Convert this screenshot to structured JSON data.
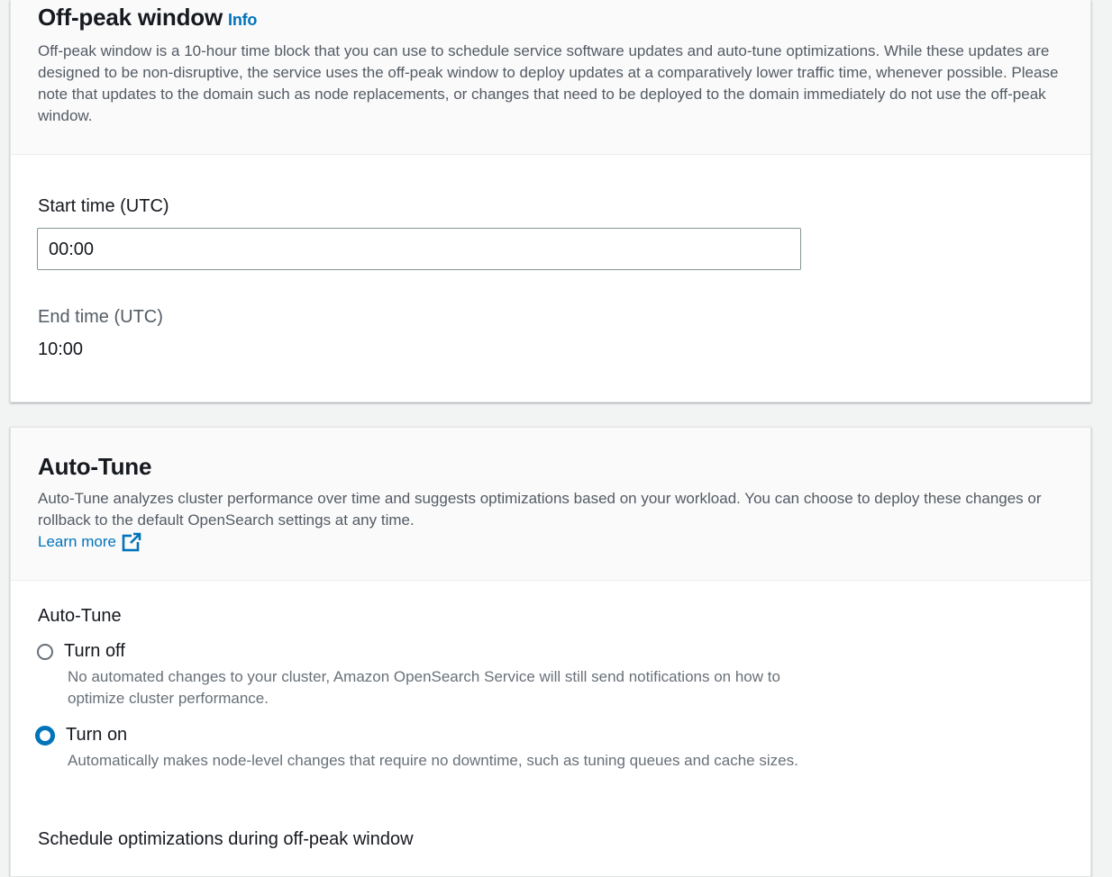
{
  "offpeak": {
    "title": "Off-peak window",
    "info": "Info",
    "description": "Off-peak window is a 10-hour time block that you can use to schedule service software updates and auto-tune optimizations. While these updates are designed to be non-disruptive, the service uses the off-peak window to deploy updates at a comparatively lower traffic time, whenever possible. Please note that updates to the domain such as node replacements, or changes that need to be deployed to the domain immediately do not use the off-peak window.",
    "start_label": "Start time (UTC)",
    "start_value": "00:00",
    "end_label": "End time (UTC)",
    "end_value": "10:00"
  },
  "autotune": {
    "title": "Auto-Tune",
    "description": "Auto-Tune analyzes cluster performance over time and suggests optimizations based on your workload. You can choose to deploy these changes or rollback to the default OpenSearch settings at any time.",
    "learn_more": "Learn more",
    "field_label": "Auto-Tune",
    "options": [
      {
        "label": "Turn off",
        "description": "No automated changes to your cluster, Amazon OpenSearch Service will still send notifications on how to optimize cluster performance.",
        "selected": false
      },
      {
        "label": "Turn on",
        "description": "Automatically makes node-level changes that require no downtime, such as tuning queues and cache sizes.",
        "selected": true
      }
    ],
    "schedule_label": "Schedule optimizations during off-peak window"
  },
  "colors": {
    "link": "#0073bb",
    "selected_radio": "#0073bb",
    "header_bg": "#fafafa",
    "page_bg": "#f2f3f3"
  }
}
